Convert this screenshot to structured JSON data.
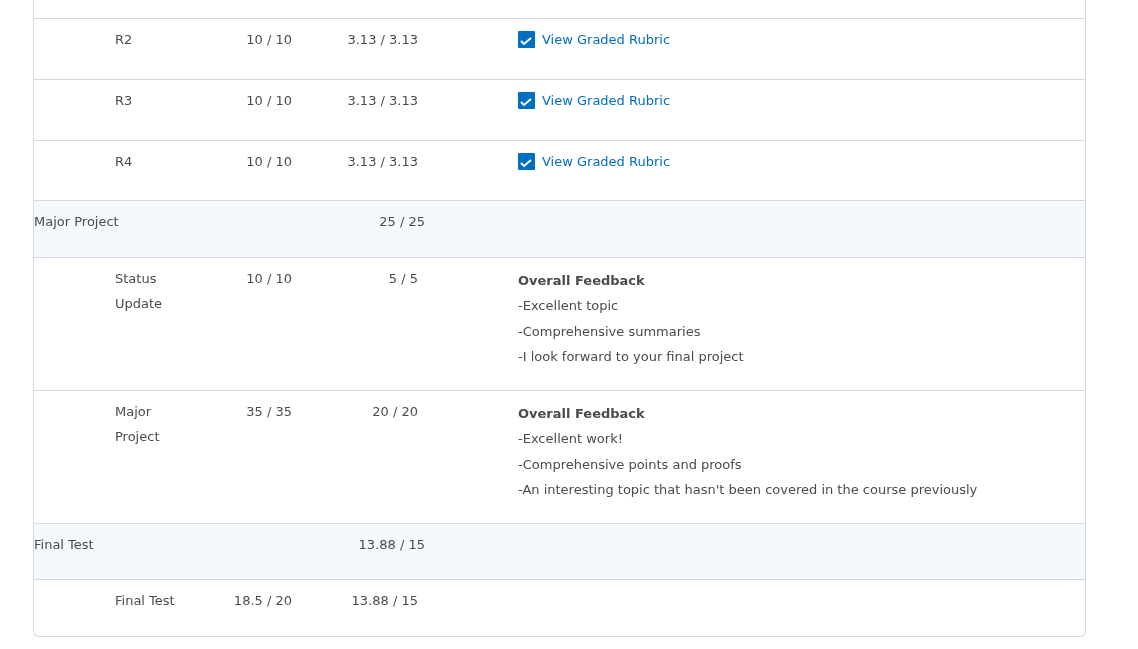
{
  "grades_table": {
    "rows": [
      {
        "kind": "item",
        "name": "R2",
        "points": "10 / 10",
        "weight": "3.13 / 3.13",
        "rubric_link": "View Graded Rubric"
      },
      {
        "kind": "item",
        "name": "R3",
        "points": "10 / 10",
        "weight": "3.13 / 3.13",
        "rubric_link": "View Graded Rubric"
      },
      {
        "kind": "item",
        "name": "R4",
        "points": "10 / 10",
        "weight": "3.13 / 3.13",
        "rubric_link": "View Graded Rubric"
      },
      {
        "kind": "category",
        "name": "Major Project",
        "weight": "25 / 25"
      },
      {
        "kind": "item",
        "name": "Status Update",
        "points": "10 / 10",
        "weight": "5 / 5",
        "feedback": {
          "title": "Overall Feedback",
          "lines": [
            "-Excellent topic",
            "-Comprehensive summaries",
            "-I look forward to your final project"
          ]
        }
      },
      {
        "kind": "item",
        "name": "Major Project",
        "points": "35 / 35",
        "weight": "20 / 20",
        "feedback": {
          "title": "Overall Feedback",
          "lines": [
            "-Excellent work!",
            "-Comprehensive points and proofs",
            "-An interesting topic that hasn't been covered in the course previously"
          ]
        }
      },
      {
        "kind": "category",
        "name": "Final Test",
        "weight": "13.88 / 15"
      },
      {
        "kind": "item",
        "name": "Final Test",
        "points": "18.5 / 20",
        "weight": "13.88 / 15"
      }
    ]
  }
}
